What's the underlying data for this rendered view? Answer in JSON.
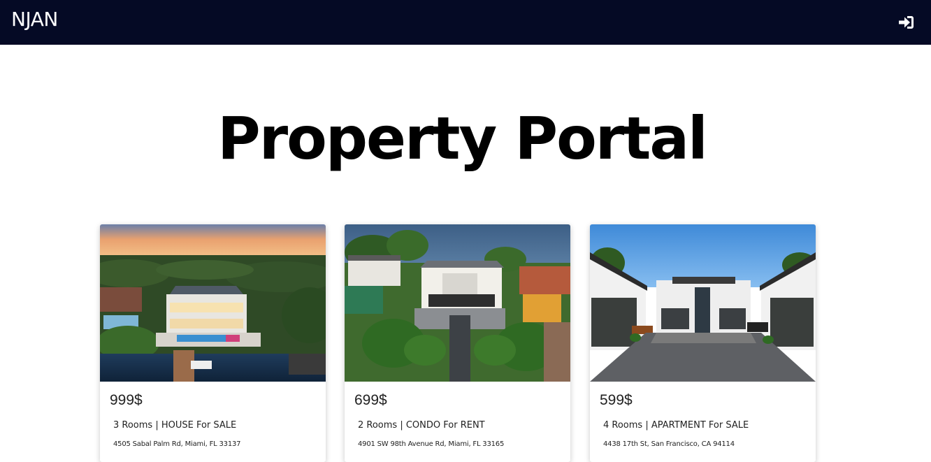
{
  "navbar": {
    "brand": "NJAN",
    "login_icon": "sign-in-icon",
    "background": "#050a25"
  },
  "page": {
    "title": "Property Portal"
  },
  "listings": [
    {
      "price": "999$",
      "details": "3 Rooms | HOUSE For SALE",
      "address": "4505 Sabal Palm Rd, Miami, FL 33137",
      "photo": "aerial waterfront mansion at sunset"
    },
    {
      "price": "699$",
      "details": "2 Rooms | CONDO For RENT",
      "address": "4901 SW 98th Avenue Rd, Miami, FL 33165",
      "photo": "aerial oceanfront estate with palm-lined drive"
    },
    {
      "price": "599$",
      "details": "4 Rooms | APARTMENT For SALE",
      "address": "4438 17th St, San Francisco, CA 94114",
      "photo": "modern house with courtyard driveway"
    }
  ]
}
